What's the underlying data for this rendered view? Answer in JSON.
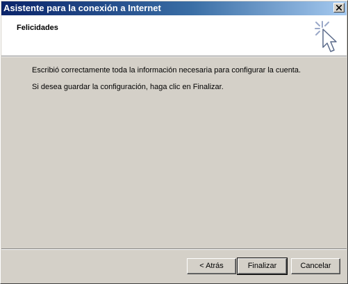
{
  "window": {
    "title": "Asistente para la conexión a Internet",
    "close_icon": "close-icon"
  },
  "header": {
    "title": "Felicidades",
    "icon": "wizard-cursor-icon"
  },
  "content": {
    "line1": "Escribió correctamente toda la información necesaria para configurar la cuenta.",
    "line2": "Si desea guardar la configuración, haga clic en Finalizar."
  },
  "buttons": {
    "back": "< Atrás",
    "finish": "Finalizar",
    "cancel": "Cancelar"
  },
  "colors": {
    "titlebar_start": "#0a246a",
    "titlebar_end": "#a6caf0",
    "face": "#d4d0c8"
  }
}
